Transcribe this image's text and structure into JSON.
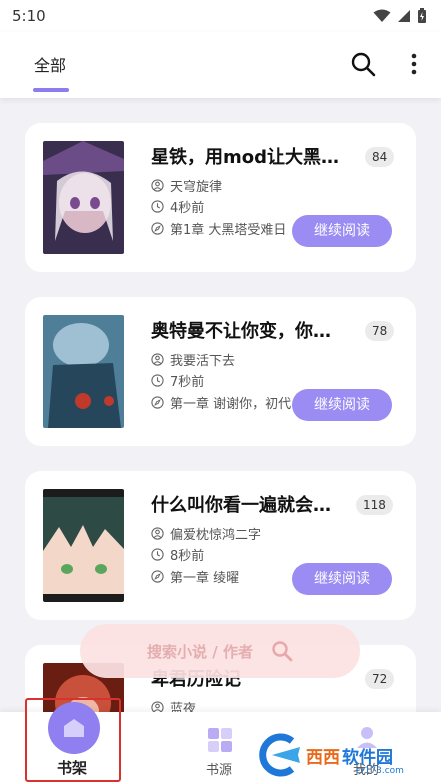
{
  "status_bar": {
    "time": "5:10"
  },
  "app_bar": {
    "tab_label": "全部"
  },
  "books": [
    {
      "title": "星铁，用mod让大黑塔…",
      "badge": "84",
      "author": "天穹旋律",
      "time": "4秒前",
      "chapter": "第1章 大黑塔受难日",
      "button": "继续阅读",
      "cover_colors": [
        "#3a2e4e",
        "#d9b8c6",
        "#6b4c86"
      ]
    },
    {
      "title": "奥特曼不让你变，你…",
      "badge": "78",
      "author": "我要活下去",
      "time": "7秒前",
      "chapter": "第一章 谢谢你，初代",
      "button": "继续阅读",
      "cover_colors": [
        "#4f7e98",
        "#9fc0d2",
        "#26465c"
      ]
    },
    {
      "title": "什么叫你看一遍就会…",
      "badge": "118",
      "author": "偏爱枕惊鸿二字",
      "time": "8秒前",
      "chapter": "第一章 绫曜",
      "button": "继续阅读",
      "cover_colors": [
        "#2d4a45",
        "#f3d7c9",
        "#1c1c1c"
      ]
    },
    {
      "title": "卑君历险记",
      "badge": "72",
      "author": "蓝夜",
      "cover_colors": [
        "#6a1e12",
        "#c9503a",
        "#f0b8a4"
      ]
    }
  ],
  "search_float": {
    "label": "搜索小说 / 作者"
  },
  "bottom_nav": {
    "bookshelf": "书架",
    "source": "书源",
    "mine": "我的"
  },
  "watermark": {
    "brand_a": "西西",
    "brand_b": "软件园",
    "url": "cr173.com"
  },
  "colors": {
    "accent": "#8b7cf0",
    "button": "#9a8cf2",
    "highlight_border": "#d93030"
  }
}
